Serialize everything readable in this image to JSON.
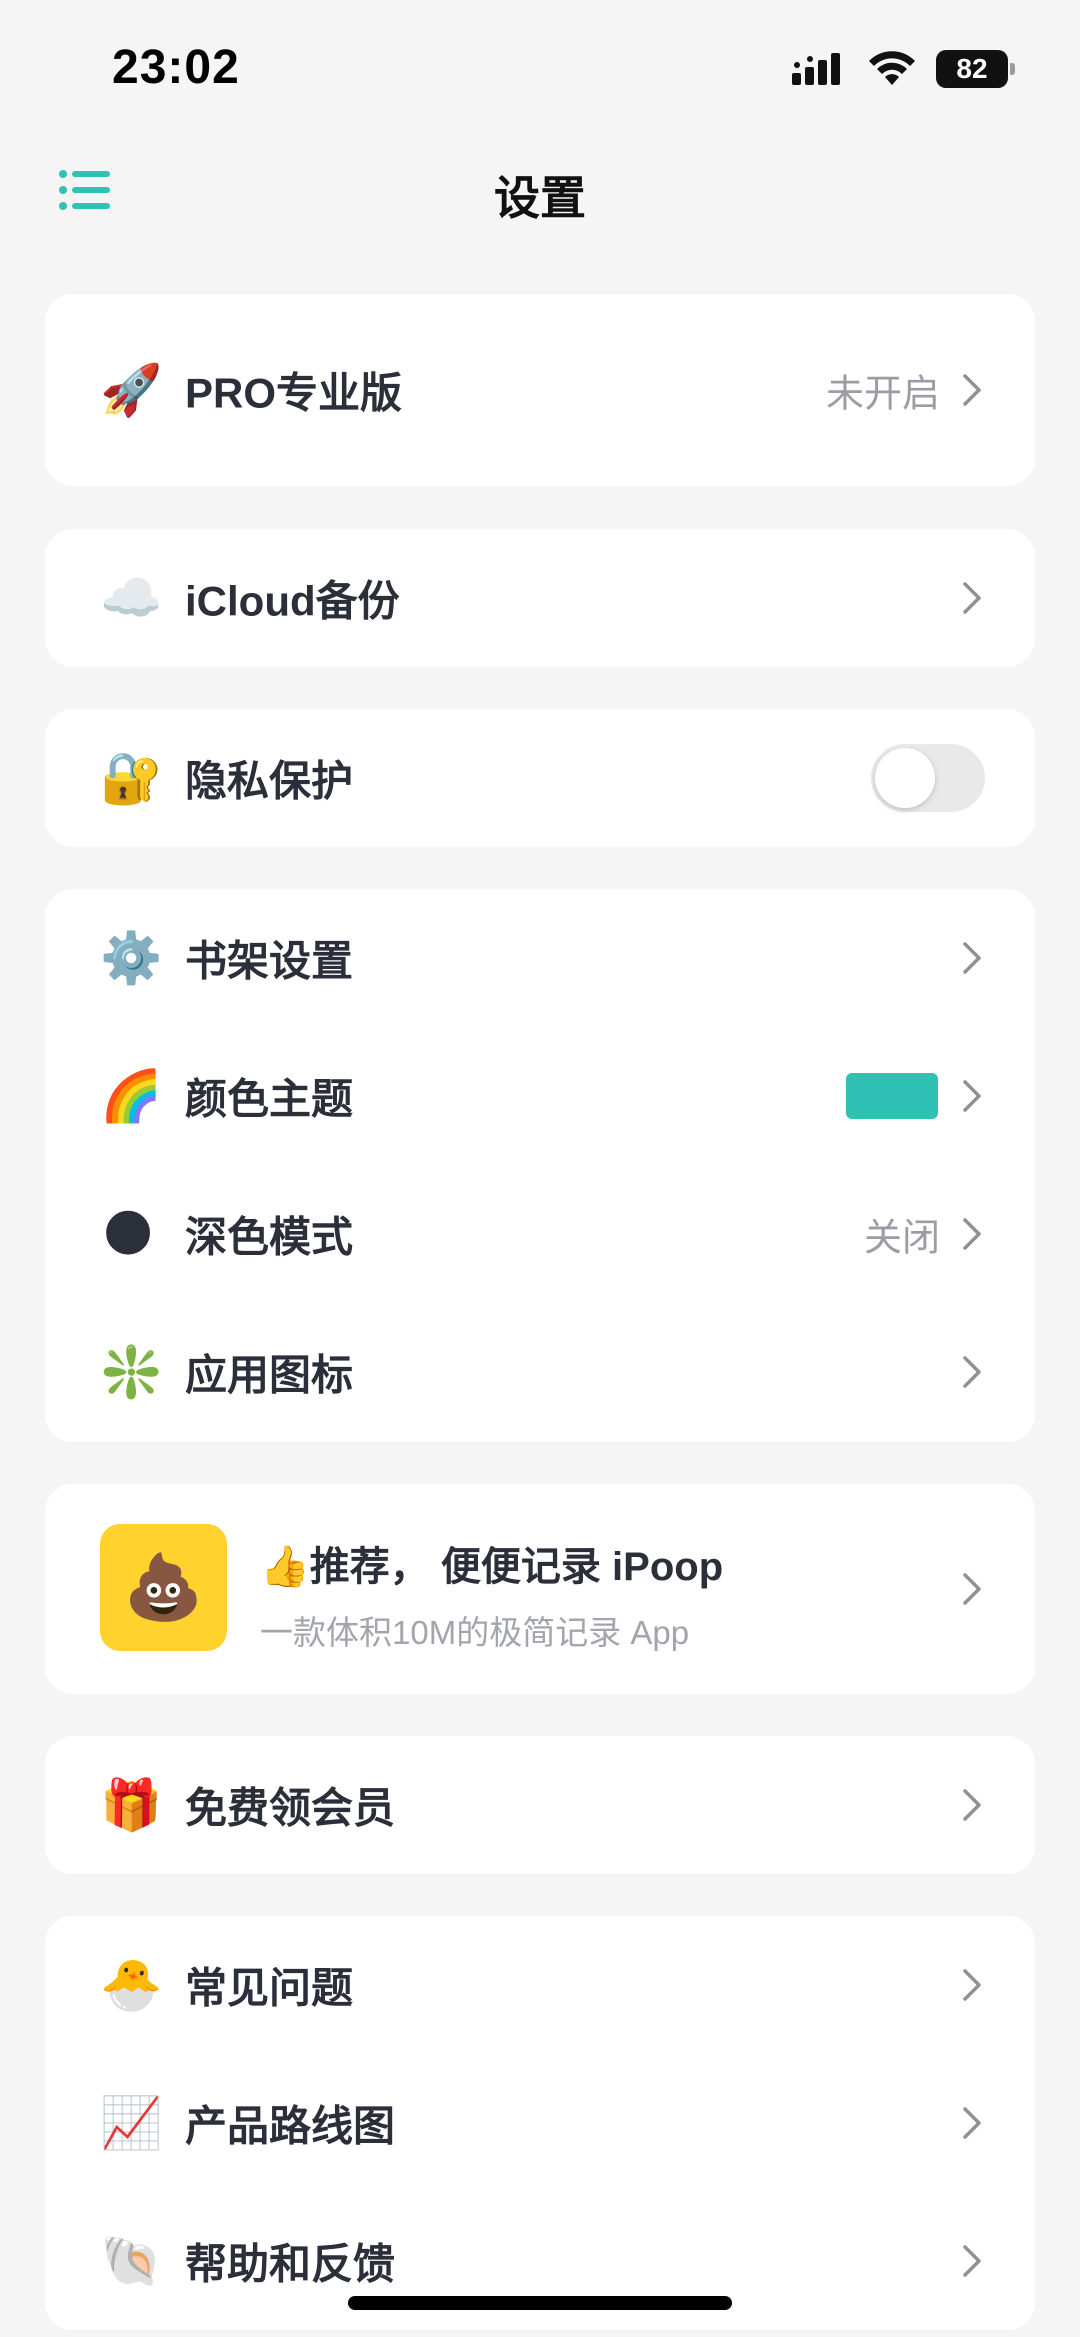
{
  "status_bar": {
    "time": "23:02",
    "battery": "82"
  },
  "nav": {
    "title": "设置",
    "menu_icon": "list-menu-icon"
  },
  "accent_color": "#2ec1b4",
  "pro": {
    "emoji": "🚀",
    "label": "PRO专业版",
    "value": "未开启"
  },
  "icloud": {
    "emoji": "☁️",
    "label": "iCloud备份"
  },
  "privacy": {
    "emoji": "🔐",
    "label": "隐私保护",
    "toggle_on": false
  },
  "general": {
    "shelf": {
      "emoji": "⚙️",
      "label": "书架设置"
    },
    "theme": {
      "emoji": "🌈",
      "label": "颜色主题",
      "swatch_color": "#2ec1b4"
    },
    "dark": {
      "emoji": "🌑",
      "label": "深色模式",
      "value": "关闭"
    },
    "icon": {
      "emoji": "❇️",
      "label": "应用图标"
    }
  },
  "recommend": {
    "app_emoji": "💩",
    "title": "👍推荐， 便便记录 iPoop",
    "subtitle": "一款体积10M的极简记录 App"
  },
  "free_member": {
    "emoji": "🎁",
    "label": "免费领会员"
  },
  "support": {
    "faq": {
      "emoji": "🐣",
      "label": "常见问题"
    },
    "roadmap": {
      "emoji": "📈",
      "label": "产品路线图"
    },
    "feedback": {
      "emoji": "🐚",
      "label": "帮助和反馈"
    }
  }
}
